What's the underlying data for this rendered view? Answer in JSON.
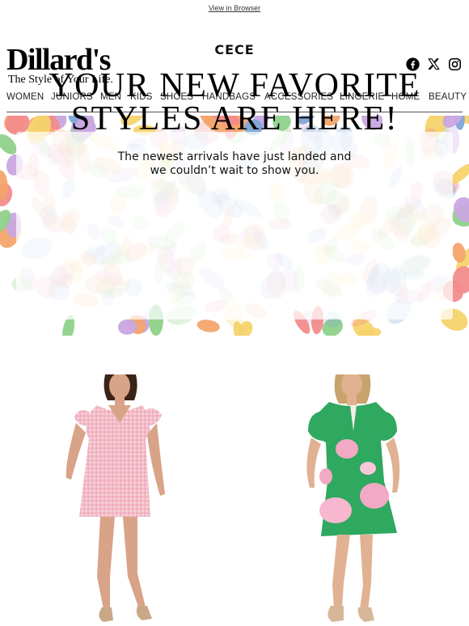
{
  "header": {
    "view_in_browser": "View in Browser",
    "logo": {
      "name": "Dillard's",
      "tagline": "The Style of Your Life."
    },
    "social_icons": [
      "facebook-icon",
      "x-icon",
      "instagram-icon"
    ]
  },
  "nav": {
    "items": [
      "WOMEN",
      "JUNIORS",
      "MEN",
      "KIDS",
      "SHOES",
      "HANDBAGS",
      "ACCESSORIES",
      "LINGERIE",
      "HOME",
      "BEAUTY"
    ]
  },
  "hero": {
    "brand": "CECE",
    "title_line1": "YOUR NEW FAVORITE",
    "title_line2": "STYLES ARE HERE!",
    "subtitle_line1": "The newest arrivals have just landed and",
    "subtitle_line2": "we couldn’t wait to show you.",
    "pattern_colors": [
      "#f28c8c",
      "#8fd18a",
      "#7fa6d9",
      "#f6d36b",
      "#c9a6e0",
      "#f4a46b"
    ]
  },
  "products": [
    {
      "image": "pink-gingham-dress",
      "dress_color": "#f2b8c6"
    },
    {
      "image": "green-floral-dress",
      "dress_color": "#2fa860"
    }
  ]
}
